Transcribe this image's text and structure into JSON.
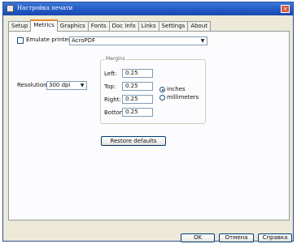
{
  "window": {
    "title": "Настройка печати",
    "close_label": "×"
  },
  "tabs": [
    {
      "label": "Setup",
      "active": false
    },
    {
      "label": "Metrics",
      "active": true
    },
    {
      "label": "Graphics",
      "active": false
    },
    {
      "label": "Fonts",
      "active": false
    },
    {
      "label": "Doc Info",
      "active": false
    },
    {
      "label": "Links",
      "active": false
    },
    {
      "label": "Settings",
      "active": false
    },
    {
      "label": "About",
      "active": false
    }
  ],
  "metrics": {
    "emulate_label": "Emulate printer:",
    "emulate_checked": false,
    "printer_value": "AcroPDF",
    "resolution_label": "Resolution:",
    "resolution_value": "300 dpi",
    "margins_title": "Margins",
    "margins": {
      "left_label": "Left:",
      "left_value": "0.25",
      "top_label": "Top:",
      "top_value": "0.25",
      "right_label": "Right:",
      "right_value": "0.25",
      "bottom_label": "Bottom:",
      "bottom_value": "0.25"
    },
    "units": {
      "inches_label": "inches",
      "inches_selected": true,
      "mm_label": "millimeters",
      "mm_selected": false
    },
    "restore_label": "Restore defaults"
  },
  "footer": {
    "ok_label": "OK",
    "cancel_label": "Отмена",
    "help_label": "Справка"
  },
  "icons": {
    "dropdown": "chevron-down-icon",
    "close": "close-icon",
    "app": "printer-icon"
  },
  "colors": {
    "titlebar": "#2157c3",
    "dialog_bg": "#ece9d8",
    "tab_highlight": "#e68b2c"
  }
}
